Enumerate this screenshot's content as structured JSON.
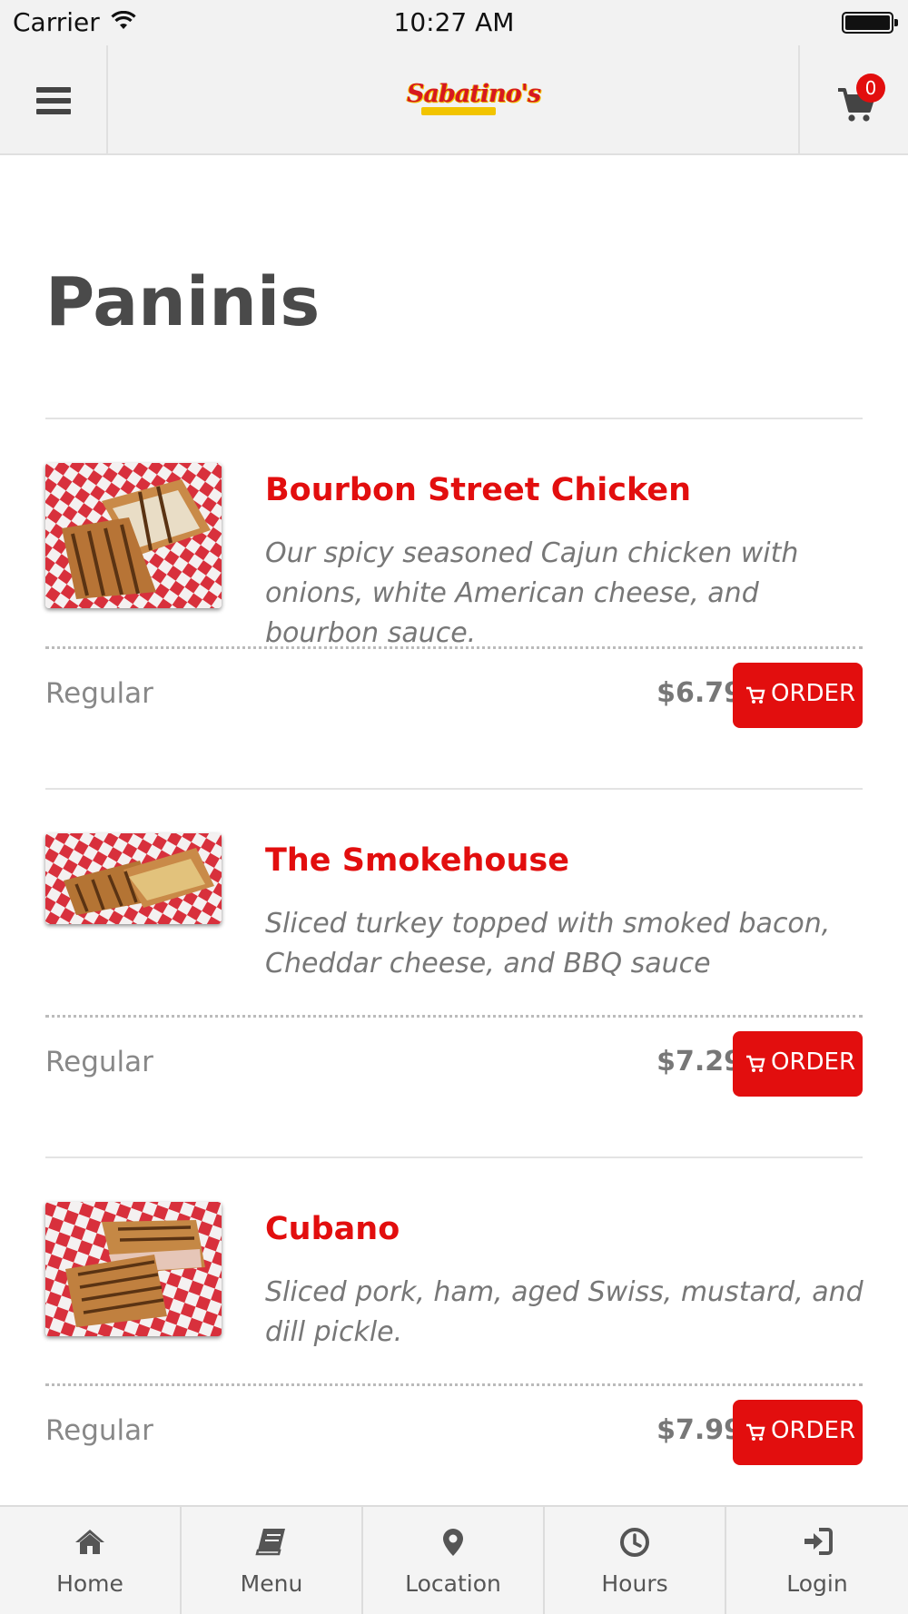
{
  "status_bar": {
    "carrier": "Carrier",
    "time": "10:27 AM"
  },
  "header": {
    "menu_icon": "hamburger-icon",
    "logo_text": "Sabatino's",
    "cart_icon": "cart-icon",
    "cart_count": "0"
  },
  "page": {
    "title": "Paninis"
  },
  "items": [
    {
      "name": "Bourbon Street Chicken",
      "description": "Our spicy seasoned Cajun chicken with onions, white American cheese, and bourbon sauce.",
      "size": "Regular",
      "price": "$6.79",
      "order_label": "ORDER"
    },
    {
      "name": "The Smokehouse",
      "description": "Sliced turkey topped with smoked bacon, Cheddar cheese, and BBQ sauce",
      "size": "Regular",
      "price": "$7.29",
      "order_label": "ORDER"
    },
    {
      "name": "Cubano",
      "description": "Sliced pork, ham, aged Swiss, mustard, and dill pickle.",
      "size": "Regular",
      "price": "$7.99",
      "order_label": "ORDER"
    }
  ],
  "tabs": [
    {
      "label": "Home",
      "icon": "home-icon"
    },
    {
      "label": "Menu",
      "icon": "book-icon"
    },
    {
      "label": "Location",
      "icon": "map-pin-icon"
    },
    {
      "label": "Hours",
      "icon": "clock-icon"
    },
    {
      "label": "Login",
      "icon": "sign-in-icon"
    }
  ],
  "colors": {
    "accent": "#e20e0e",
    "header_bg": "#f2f2f2",
    "title": "#4a4a4a",
    "muted_text": "#777777"
  }
}
